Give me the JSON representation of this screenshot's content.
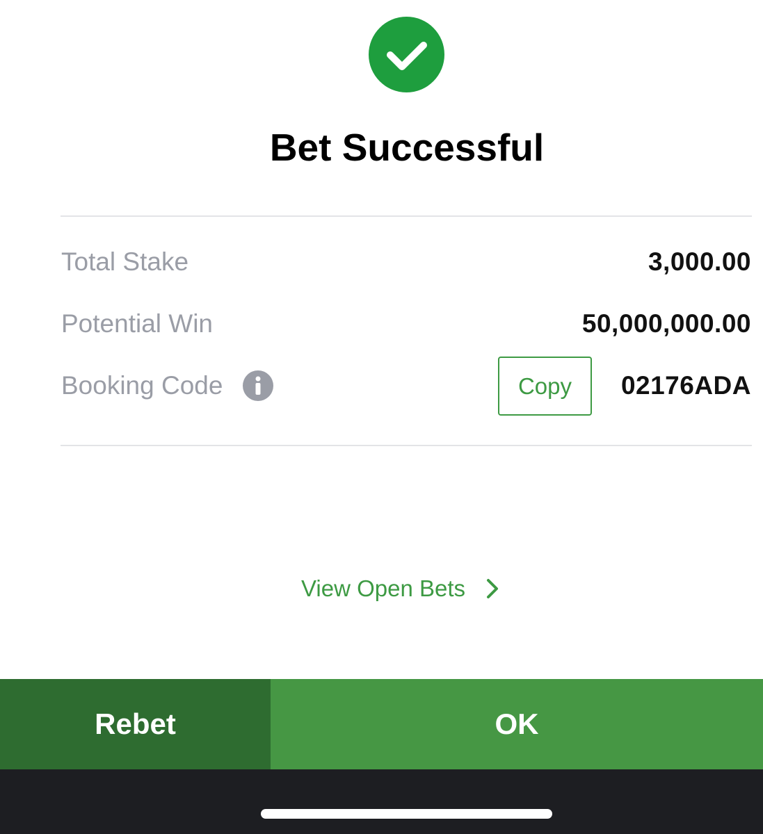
{
  "header": {
    "title": "Bet Successful",
    "icon": "check-circle-icon",
    "icon_color": "#1e9e3e"
  },
  "summary": {
    "rows": [
      {
        "label": "Total Stake",
        "value": "3,000.00"
      },
      {
        "label": "Potential Win",
        "value": "50,000,000.00"
      },
      {
        "label": "Booking Code",
        "value": "02176ADA"
      }
    ],
    "info_icon": "info-icon",
    "copy_label": "Copy"
  },
  "links": {
    "view_open_bets": "View Open Bets",
    "icon": "chevron-right-icon"
  },
  "actions": {
    "rebet_label": "Rebet",
    "ok_label": "OK"
  },
  "colors": {
    "accent_green": "#3d9a43",
    "rebet_bg": "#2e6c30",
    "ok_bg": "#469744",
    "label_gray": "#9a9da6"
  }
}
